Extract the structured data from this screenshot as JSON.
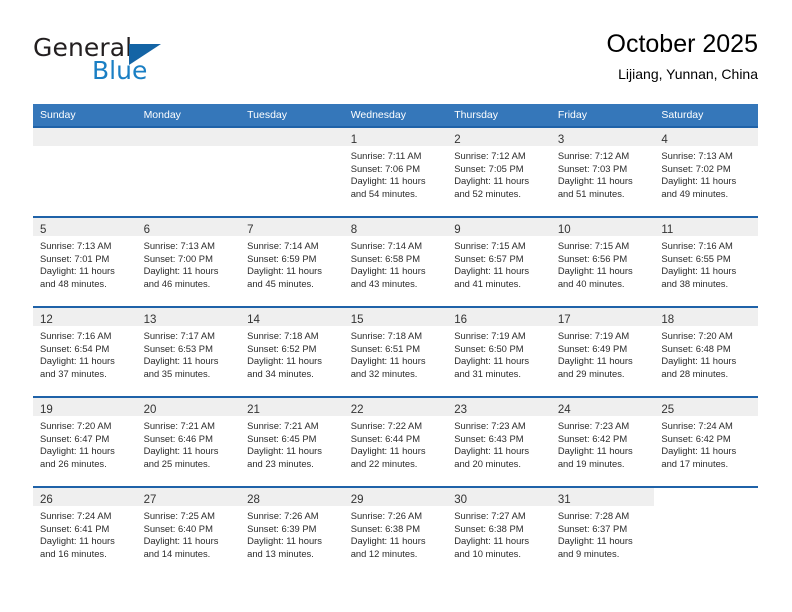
{
  "brand": {
    "name_top": "General",
    "name_bottom": "Blue",
    "triangle_icon": "brand-triangle-icon",
    "color_dark": "#231f20",
    "color_blue": "#1a7fc4"
  },
  "header": {
    "title": "October 2025",
    "subtitle": "Lijiang, Yunnan, China"
  },
  "theme": {
    "header_bar": "#3577ba",
    "row_rule": "#1f62a8",
    "daynum_band": "#efefef"
  },
  "weekdays": [
    "Sunday",
    "Monday",
    "Tuesday",
    "Wednesday",
    "Thursday",
    "Friday",
    "Saturday"
  ],
  "weeks": [
    [
      {
        "day": "",
        "blank": true
      },
      {
        "day": "",
        "blank": true
      },
      {
        "day": "",
        "blank": true
      },
      {
        "day": "1",
        "sunrise": "Sunrise: 7:11 AM",
        "sunset": "Sunset: 7:06 PM",
        "daylight1": "Daylight: 11 hours",
        "daylight2": "and 54 minutes."
      },
      {
        "day": "2",
        "sunrise": "Sunrise: 7:12 AM",
        "sunset": "Sunset: 7:05 PM",
        "daylight1": "Daylight: 11 hours",
        "daylight2": "and 52 minutes."
      },
      {
        "day": "3",
        "sunrise": "Sunrise: 7:12 AM",
        "sunset": "Sunset: 7:03 PM",
        "daylight1": "Daylight: 11 hours",
        "daylight2": "and 51 minutes."
      },
      {
        "day": "4",
        "sunrise": "Sunrise: 7:13 AM",
        "sunset": "Sunset: 7:02 PM",
        "daylight1": "Daylight: 11 hours",
        "daylight2": "and 49 minutes."
      }
    ],
    [
      {
        "day": "5",
        "sunrise": "Sunrise: 7:13 AM",
        "sunset": "Sunset: 7:01 PM",
        "daylight1": "Daylight: 11 hours",
        "daylight2": "and 48 minutes."
      },
      {
        "day": "6",
        "sunrise": "Sunrise: 7:13 AM",
        "sunset": "Sunset: 7:00 PM",
        "daylight1": "Daylight: 11 hours",
        "daylight2": "and 46 minutes."
      },
      {
        "day": "7",
        "sunrise": "Sunrise: 7:14 AM",
        "sunset": "Sunset: 6:59 PM",
        "daylight1": "Daylight: 11 hours",
        "daylight2": "and 45 minutes."
      },
      {
        "day": "8",
        "sunrise": "Sunrise: 7:14 AM",
        "sunset": "Sunset: 6:58 PM",
        "daylight1": "Daylight: 11 hours",
        "daylight2": "and 43 minutes."
      },
      {
        "day": "9",
        "sunrise": "Sunrise: 7:15 AM",
        "sunset": "Sunset: 6:57 PM",
        "daylight1": "Daylight: 11 hours",
        "daylight2": "and 41 minutes."
      },
      {
        "day": "10",
        "sunrise": "Sunrise: 7:15 AM",
        "sunset": "Sunset: 6:56 PM",
        "daylight1": "Daylight: 11 hours",
        "daylight2": "and 40 minutes."
      },
      {
        "day": "11",
        "sunrise": "Sunrise: 7:16 AM",
        "sunset": "Sunset: 6:55 PM",
        "daylight1": "Daylight: 11 hours",
        "daylight2": "and 38 minutes."
      }
    ],
    [
      {
        "day": "12",
        "sunrise": "Sunrise: 7:16 AM",
        "sunset": "Sunset: 6:54 PM",
        "daylight1": "Daylight: 11 hours",
        "daylight2": "and 37 minutes."
      },
      {
        "day": "13",
        "sunrise": "Sunrise: 7:17 AM",
        "sunset": "Sunset: 6:53 PM",
        "daylight1": "Daylight: 11 hours",
        "daylight2": "and 35 minutes."
      },
      {
        "day": "14",
        "sunrise": "Sunrise: 7:18 AM",
        "sunset": "Sunset: 6:52 PM",
        "daylight1": "Daylight: 11 hours",
        "daylight2": "and 34 minutes."
      },
      {
        "day": "15",
        "sunrise": "Sunrise: 7:18 AM",
        "sunset": "Sunset: 6:51 PM",
        "daylight1": "Daylight: 11 hours",
        "daylight2": "and 32 minutes."
      },
      {
        "day": "16",
        "sunrise": "Sunrise: 7:19 AM",
        "sunset": "Sunset: 6:50 PM",
        "daylight1": "Daylight: 11 hours",
        "daylight2": "and 31 minutes."
      },
      {
        "day": "17",
        "sunrise": "Sunrise: 7:19 AM",
        "sunset": "Sunset: 6:49 PM",
        "daylight1": "Daylight: 11 hours",
        "daylight2": "and 29 minutes."
      },
      {
        "day": "18",
        "sunrise": "Sunrise: 7:20 AM",
        "sunset": "Sunset: 6:48 PM",
        "daylight1": "Daylight: 11 hours",
        "daylight2": "and 28 minutes."
      }
    ],
    [
      {
        "day": "19",
        "sunrise": "Sunrise: 7:20 AM",
        "sunset": "Sunset: 6:47 PM",
        "daylight1": "Daylight: 11 hours",
        "daylight2": "and 26 minutes."
      },
      {
        "day": "20",
        "sunrise": "Sunrise: 7:21 AM",
        "sunset": "Sunset: 6:46 PM",
        "daylight1": "Daylight: 11 hours",
        "daylight2": "and 25 minutes."
      },
      {
        "day": "21",
        "sunrise": "Sunrise: 7:21 AM",
        "sunset": "Sunset: 6:45 PM",
        "daylight1": "Daylight: 11 hours",
        "daylight2": "and 23 minutes."
      },
      {
        "day": "22",
        "sunrise": "Sunrise: 7:22 AM",
        "sunset": "Sunset: 6:44 PM",
        "daylight1": "Daylight: 11 hours",
        "daylight2": "and 22 minutes."
      },
      {
        "day": "23",
        "sunrise": "Sunrise: 7:23 AM",
        "sunset": "Sunset: 6:43 PM",
        "daylight1": "Daylight: 11 hours",
        "daylight2": "and 20 minutes."
      },
      {
        "day": "24",
        "sunrise": "Sunrise: 7:23 AM",
        "sunset": "Sunset: 6:42 PM",
        "daylight1": "Daylight: 11 hours",
        "daylight2": "and 19 minutes."
      },
      {
        "day": "25",
        "sunrise": "Sunrise: 7:24 AM",
        "sunset": "Sunset: 6:42 PM",
        "daylight1": "Daylight: 11 hours",
        "daylight2": "and 17 minutes."
      }
    ],
    [
      {
        "day": "26",
        "sunrise": "Sunrise: 7:24 AM",
        "sunset": "Sunset: 6:41 PM",
        "daylight1": "Daylight: 11 hours",
        "daylight2": "and 16 minutes."
      },
      {
        "day": "27",
        "sunrise": "Sunrise: 7:25 AM",
        "sunset": "Sunset: 6:40 PM",
        "daylight1": "Daylight: 11 hours",
        "daylight2": "and 14 minutes."
      },
      {
        "day": "28",
        "sunrise": "Sunrise: 7:26 AM",
        "sunset": "Sunset: 6:39 PM",
        "daylight1": "Daylight: 11 hours",
        "daylight2": "and 13 minutes."
      },
      {
        "day": "29",
        "sunrise": "Sunrise: 7:26 AM",
        "sunset": "Sunset: 6:38 PM",
        "daylight1": "Daylight: 11 hours",
        "daylight2": "and 12 minutes."
      },
      {
        "day": "30",
        "sunrise": "Sunrise: 7:27 AM",
        "sunset": "Sunset: 6:38 PM",
        "daylight1": "Daylight: 11 hours",
        "daylight2": "and 10 minutes."
      },
      {
        "day": "31",
        "sunrise": "Sunrise: 7:28 AM",
        "sunset": "Sunset: 6:37 PM",
        "daylight1": "Daylight: 11 hours",
        "daylight2": "and 9 minutes."
      },
      {
        "day": "",
        "blank": true,
        "nofill": true
      }
    ]
  ]
}
